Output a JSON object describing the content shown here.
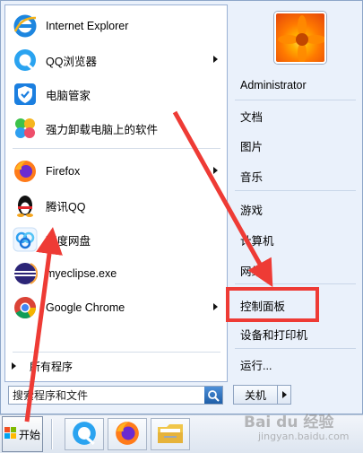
{
  "start_menu": {
    "programs": [
      {
        "label": "Internet Explorer",
        "icon": "internet-explorer-icon",
        "has_submenu": false
      },
      {
        "label": "QQ浏览器",
        "icon": "qq-browser-icon",
        "has_submenu": true
      },
      {
        "label": "电脑管家",
        "icon": "pc-manager-icon",
        "has_submenu": false
      },
      {
        "label": "强力卸载电脑上的软件",
        "icon": "uninstaller-icon",
        "has_submenu": false
      },
      {
        "label": "Firefox",
        "icon": "firefox-icon",
        "has_submenu": true
      },
      {
        "label": "腾讯QQ",
        "icon": "qq-penguin-icon",
        "has_submenu": false
      },
      {
        "label": "百度网盘",
        "icon": "baidu-netdisk-icon",
        "has_submenu": false
      },
      {
        "label": "myeclipse.exe",
        "icon": "myeclipse-icon",
        "has_submenu": false
      },
      {
        "label": "Google Chrome",
        "icon": "chrome-icon",
        "has_submenu": true
      }
    ],
    "all_programs_label": "所有程序",
    "search": {
      "placeholder": "搜索程序和文件"
    },
    "right_items": [
      "Administrator",
      "文档",
      "图片",
      "音乐",
      "游戏",
      "计算机",
      "网络",
      "控制面板",
      "设备和打印机",
      "运行..."
    ],
    "shutdown_label": "关机"
  },
  "taskbar": {
    "start_label": "开始",
    "pinned": [
      "qq-browser-icon",
      "firefox-icon",
      "file-explorer-icon"
    ]
  },
  "watermark": {
    "main": "Bai du 经验",
    "sub": "jingyan.baidu.com"
  },
  "colors": {
    "accent_red": "#ee3b35",
    "menu_bg": "#eaf1fb"
  }
}
